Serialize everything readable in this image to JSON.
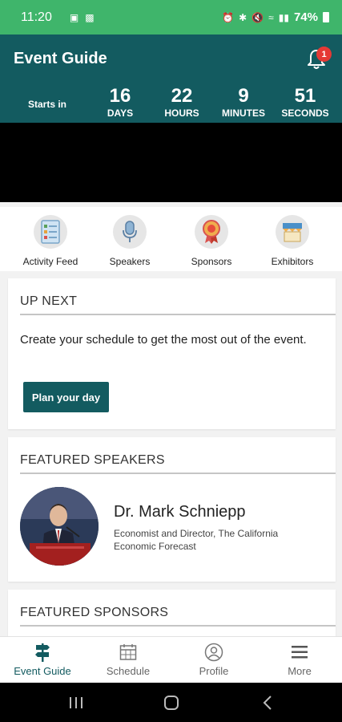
{
  "status_bar": {
    "time": "11:20",
    "battery_percent": "74%"
  },
  "header": {
    "title": "Event Guide",
    "notification_count": "1"
  },
  "countdown": {
    "starts_in_label": "Starts in",
    "units": [
      {
        "value": "16",
        "label": "DAYS"
      },
      {
        "value": "22",
        "label": "HOURS"
      },
      {
        "value": "9",
        "label": "MINUTES"
      },
      {
        "value": "51",
        "label": "SECONDS"
      }
    ]
  },
  "quick_links": [
    {
      "label": "Activity Feed",
      "icon": "activity-feed-icon"
    },
    {
      "label": "Speakers",
      "icon": "microphone-icon"
    },
    {
      "label": "Sponsors",
      "icon": "ribbon-award-icon"
    },
    {
      "label": "Exhibitors",
      "icon": "booth-icon"
    }
  ],
  "up_next": {
    "title": "UP NEXT",
    "text": "Create your schedule to get the most out of the event.",
    "button_label": "Plan your day"
  },
  "featured_speakers": {
    "title": "FEATURED SPEAKERS",
    "speaker": {
      "name": "Dr. Mark Schniepp",
      "role": "Economist and Director, The California Economic Forecast"
    }
  },
  "featured_sponsors": {
    "title": "FEATURED SPONSORS"
  },
  "bottom_nav": [
    {
      "label": "Event Guide",
      "icon": "signpost-icon",
      "active": true
    },
    {
      "label": "Schedule",
      "icon": "calendar-icon",
      "active": false
    },
    {
      "label": "Profile",
      "icon": "profile-icon",
      "active": false
    },
    {
      "label": "More",
      "icon": "menu-icon",
      "active": false
    }
  ],
  "colors": {
    "status_bar": "#3fb56b",
    "header": "#135b60",
    "badge": "#e53935"
  }
}
